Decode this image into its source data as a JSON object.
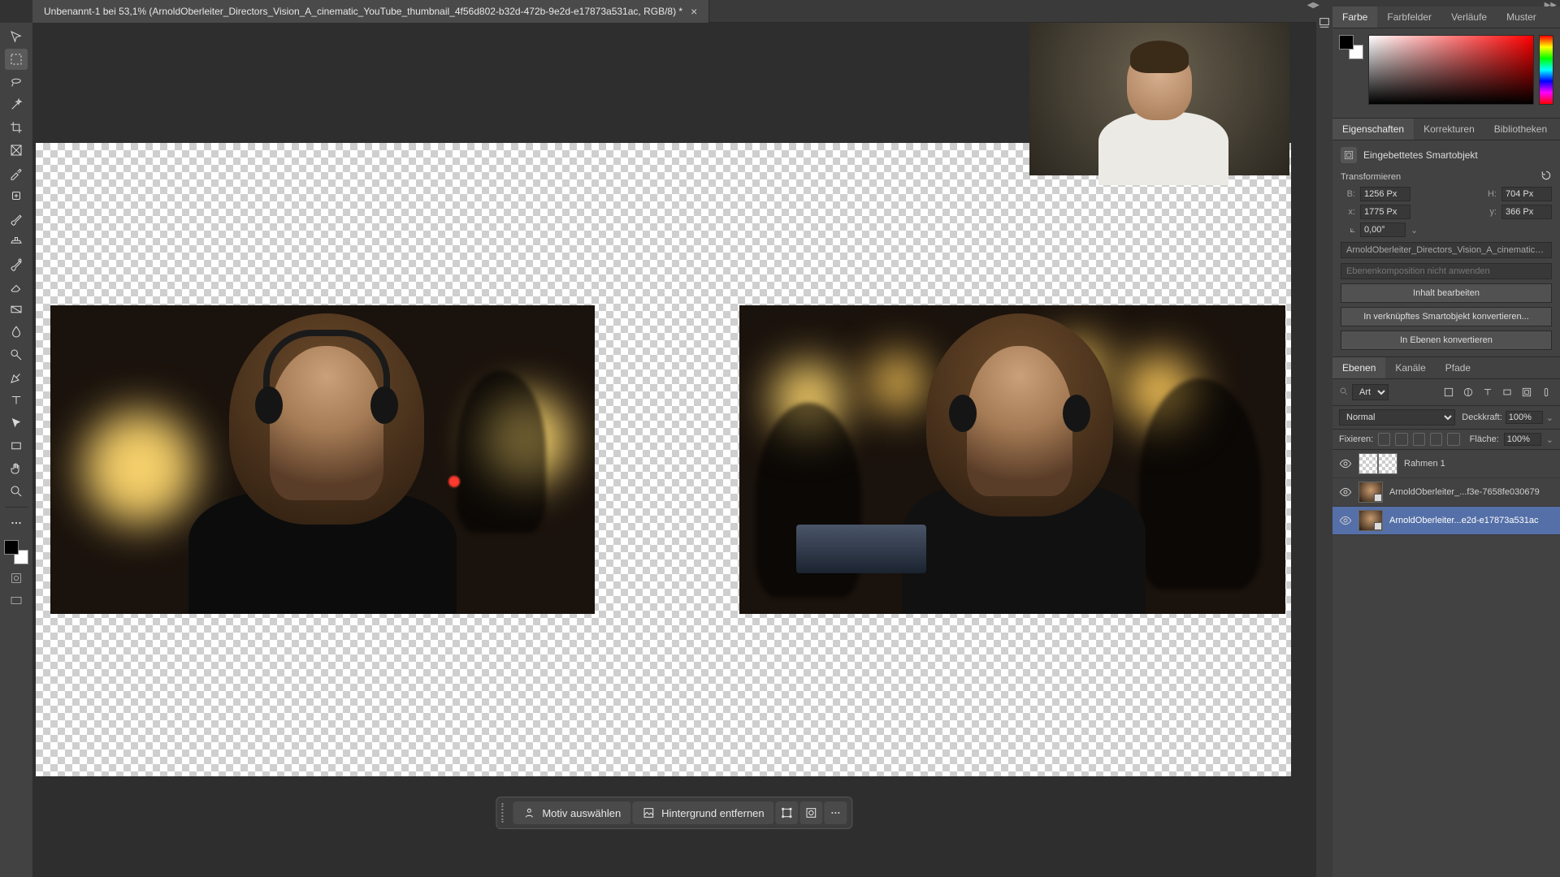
{
  "tab": {
    "title": "Unbenannt-1 bei 53,1% (ArnoldOberleiter_Directors_Vision_A_cinematic_YouTube_thumbnail_4f56d802-b32d-472b-9e2d-e17873a531ac, RGB/8) *"
  },
  "contextbar": {
    "select_subject": "Motiv auswählen",
    "remove_bg": "Hintergrund entfernen"
  },
  "panels": {
    "color": {
      "tabs": [
        "Farbe",
        "Farbfelder",
        "Verläufe",
        "Muster"
      ]
    },
    "props": {
      "tabs": [
        "Eigenschaften",
        "Korrekturen",
        "Bibliotheken"
      ],
      "object_type": "Eingebettetes Smartobjekt",
      "transform_head": "Transformieren",
      "w_label": "B:",
      "w": "1256 Px",
      "h_label": "H:",
      "h": "704 Px",
      "x_label": "x:",
      "x": "1775 Px",
      "y_label": "y:",
      "y": "366 Px",
      "angle": "0,00°",
      "filename": "ArnoldOberleiter_Directors_Vision_A_cinematic_You...",
      "comp_note": "Ebenenkomposition nicht anwenden",
      "btn_edit": "Inhalt bearbeiten",
      "btn_linked": "In verknüpftes Smartobjekt konvertieren...",
      "btn_layers": "In Ebenen konvertieren"
    },
    "layers": {
      "tabs": [
        "Ebenen",
        "Kanäle",
        "Pfade"
      ],
      "filter_kind": "Art",
      "blend": "Normal",
      "opacity_label": "Deckkraft:",
      "opacity": "100%",
      "lock_label": "Fixieren:",
      "fill_label": "Fläche:",
      "fill": "100%",
      "items": [
        {
          "name": "Rahmen 1"
        },
        {
          "name": "ArnoldOberleiter_...f3e-7658fe030679"
        },
        {
          "name": "ArnoldOberleiter...e2d-e17873a531ac"
        }
      ]
    }
  }
}
